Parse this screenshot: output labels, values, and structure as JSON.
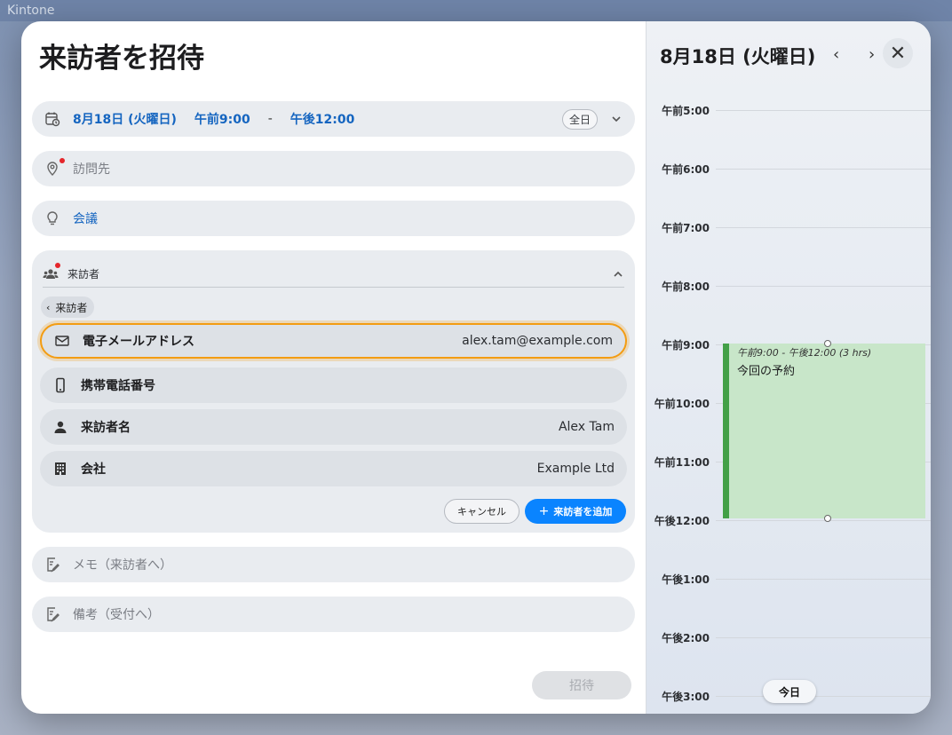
{
  "backdrop": {
    "app_title": "Kintone"
  },
  "form": {
    "title": "来訪者を招待",
    "date": {
      "day": "8月18日 (火曜日)",
      "start": "午前9:00",
      "separator": "-",
      "end": "午後12:00",
      "allday_label": "全日"
    },
    "location": {
      "placeholder": "訪問先",
      "required": true
    },
    "meeting": {
      "value": "会議"
    },
    "visitors": {
      "header_label": "来訪者",
      "back_label": "来訪者",
      "fields": [
        {
          "icon": "mail-icon",
          "label": "電子メールアドレス",
          "value": "alex.tam@example.com"
        },
        {
          "icon": "phone-icon",
          "label": "携帯電話番号",
          "value": ""
        },
        {
          "icon": "person-icon",
          "label": "来訪者名",
          "value": "Alex Tam"
        },
        {
          "icon": "building-icon",
          "label": "会社",
          "value": "Example Ltd"
        }
      ],
      "cancel_label": "キャンセル",
      "add_label": "来訪者を追加",
      "add_icon": "+"
    },
    "memo": {
      "placeholder": "メモ（来訪者へ）"
    },
    "note": {
      "placeholder": "備考（受付へ）"
    },
    "invite_label": "招待",
    "colors": {
      "accent": "#0a84ff",
      "blue_text": "#1565c0",
      "focus": "#f39c12",
      "required": "#e5262b"
    }
  },
  "calendar": {
    "title": "8月18日 (火曜日)",
    "prev_icon": "‹",
    "next_icon": "›",
    "close_icon": "✕",
    "hours": [
      "午前5:00",
      "午前6:00",
      "午前7:00",
      "午前8:00",
      "午前9:00",
      "午前10:00",
      "午前11:00",
      "午後12:00",
      "午後1:00",
      "午後2:00",
      "午後3:00"
    ],
    "event": {
      "time": "午前9:00 - 午後12:00 (3 hrs)",
      "title": "今回の予約",
      "color": "#c8e6c9",
      "bar_color": "#43a047"
    },
    "today_label": "今日"
  }
}
